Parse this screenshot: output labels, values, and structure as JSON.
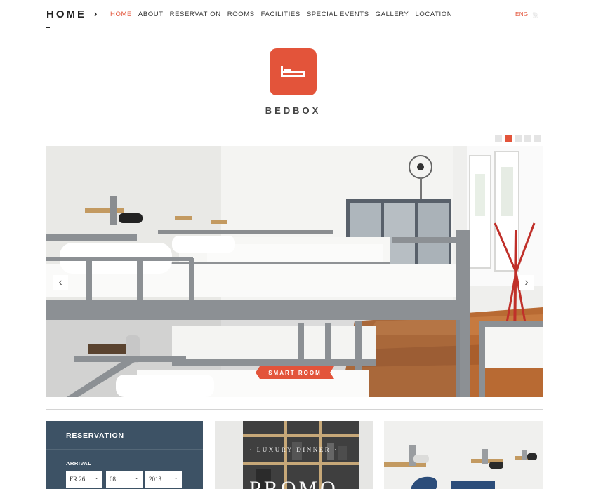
{
  "header": {
    "page_title": "HOME",
    "nav_items": [
      {
        "label": "HOME",
        "active": true
      },
      {
        "label": "ABOUT",
        "active": false
      },
      {
        "label": "RESERVATION",
        "active": false
      },
      {
        "label": "ROOMS",
        "active": false
      },
      {
        "label": "FACILITIES",
        "active": false
      },
      {
        "label": "SPECIAL EVENTS",
        "active": false
      },
      {
        "label": "GALLERY",
        "active": false
      },
      {
        "label": "LOCATION",
        "active": false
      }
    ],
    "languages": [
      {
        "label": "ENG",
        "active": true
      },
      {
        "label": "繁",
        "active": false
      }
    ]
  },
  "brand": {
    "name": "BEDBOX",
    "logo_icon": "bed-icon",
    "accent_color": "#e3543a"
  },
  "slider": {
    "slide_count": 5,
    "active_index": 1,
    "caption": "SMART ROOM",
    "prev_icon": "chevron-left-icon",
    "next_icon": "chevron-right-icon"
  },
  "reservation": {
    "title": "RESERVATION",
    "arrival_label": "ARRIVAL",
    "day": "FR 26",
    "month": "08",
    "year": "2013",
    "panel_color": "#3d5265"
  },
  "promos": {
    "dinner_label": "LUXURY DINNER",
    "dinner_heading": "PROMO"
  }
}
